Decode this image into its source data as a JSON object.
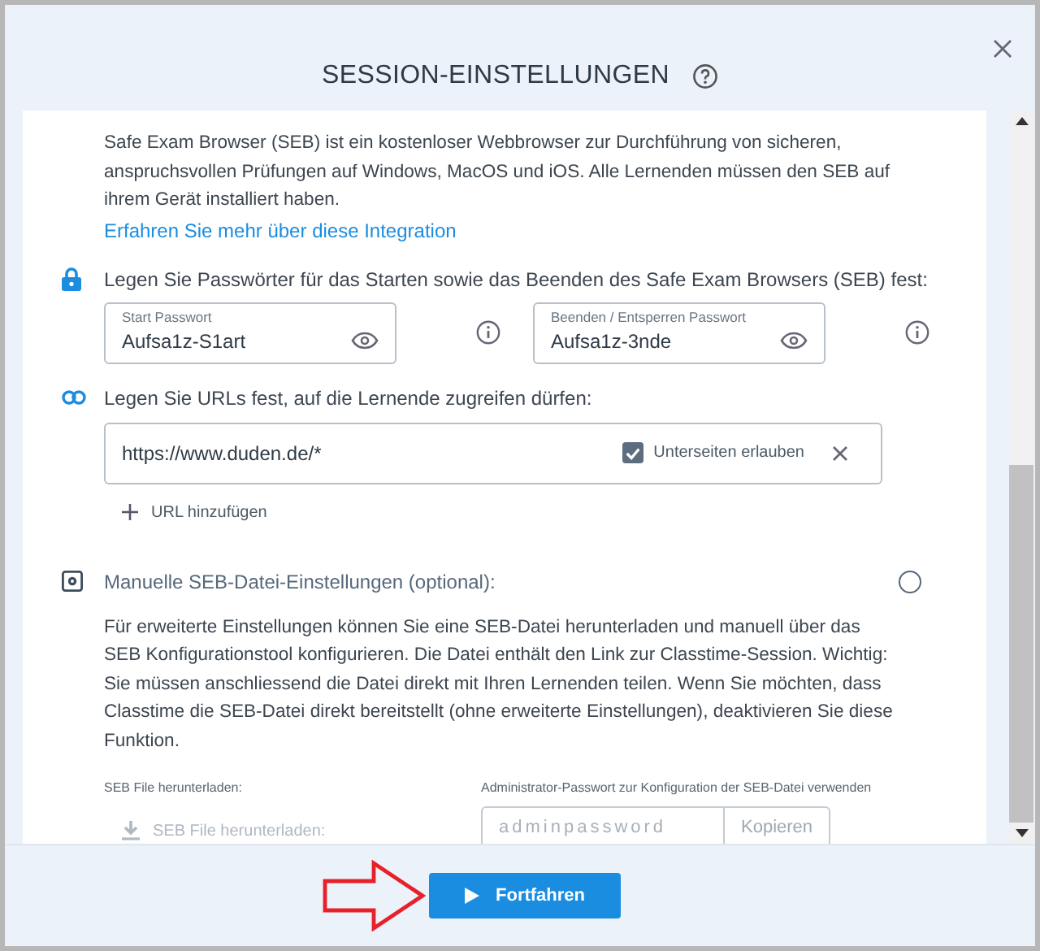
{
  "dialog": {
    "title": "SESSION-EINSTELLUNGEN"
  },
  "intro": {
    "text": "Safe Exam Browser (SEB) ist ein kostenloser Webbrowser zur Durchführung von sicheren, anspruchsvollen Prüfungen auf Windows, MacOS und iOS. Alle Lernenden müssen den SEB auf ihrem Gerät installiert haben.",
    "link": "Erfahren Sie mehr über diese Integration"
  },
  "passwords": {
    "label": "Legen Sie Passwörter für das Starten sowie das Beenden des Safe Exam Browsers (SEB) fest:",
    "fields": [
      {
        "label": "Start Passwort",
        "value": "Aufsa1z-S1art"
      },
      {
        "label": "Beenden / Entsperren Passwort",
        "value": "Aufsa1z-3nde"
      }
    ]
  },
  "urls": {
    "label": "Legen Sie URLs fest, auf die Lernende zugreifen dürfen:",
    "items": [
      {
        "value": "https://www.duden.de/*",
        "subpages_label": "Unterseiten erlauben",
        "checked": true
      }
    ],
    "add_label": "URL hinzufügen"
  },
  "manual": {
    "label": "Manuelle SEB-Datei-Einstellungen (optional):",
    "on": false,
    "description": "Für erweiterte Einstellungen können Sie eine SEB-Datei herunterladen und manuell über das SEB Konfigurationstool konfigurieren. Die Datei enthält den Link zur Classtime-Session. Wichtig: Sie müssen anschliessend die Datei direkt mit Ihren Lernenden teilen. Wenn Sie möchten, dass Classtime die SEB-Datei direkt bereitstellt (ohne erweiterte Einstellungen), deaktivieren Sie diese Funktion.",
    "download_label": "SEB File herunterladen:",
    "download_button": {
      "label": "SEB File herunterladen:",
      "disabled": true
    },
    "admin_label": "Administrator-Passwort zur Konfiguration der SEB-Datei verwenden",
    "admin_placeholder": "adminpassword",
    "copy_button": "Kopieren"
  },
  "footer": {
    "continue_button": "Fortfahren"
  }
}
